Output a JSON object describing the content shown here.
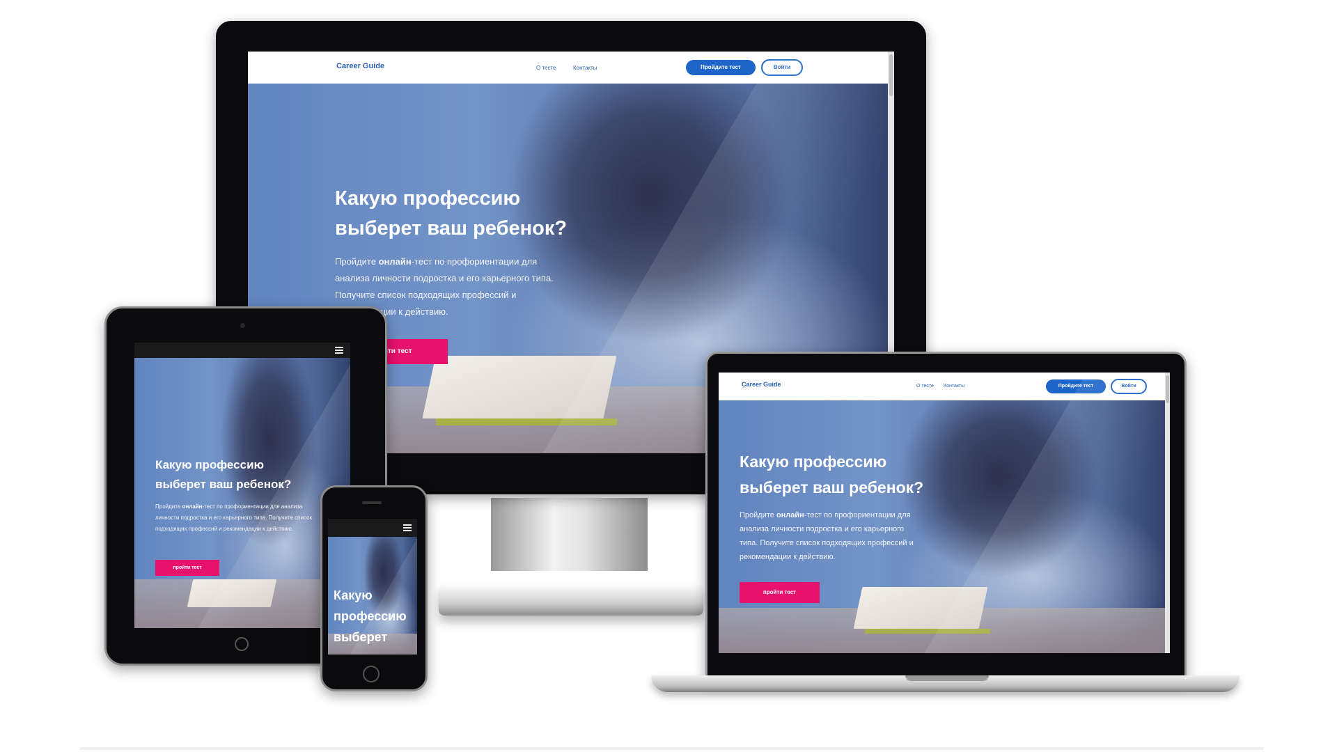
{
  "site": {
    "brand": "Career Guide",
    "nav_about": "О тесте",
    "nav_contacts": "Контакты",
    "btn_take_test": "Пройдите тест",
    "btn_login": "Войти",
    "headline_line1": "Какую профессию",
    "headline_line2": "выберет ваш ребенок?",
    "sub_pre": "Пройдите ",
    "sub_bold": "онлайн",
    "sub_post": "-тест по профориентации для анализа личности подростка и его карьерного типа. Получите список подходящих профессий и рекомендации к действию.",
    "cta_label": "пройти тест",
    "phone_headline_1": "Какую",
    "phone_headline_2": "профессию",
    "phone_headline_3": "выберет"
  },
  "icons": {
    "menu": "hamburger-menu-icon",
    "home_button": "home-button-icon"
  },
  "colors": {
    "brand_blue": "#1e65c9",
    "cta_pink": "#e6126b",
    "device_black": "#0b0b0d"
  }
}
